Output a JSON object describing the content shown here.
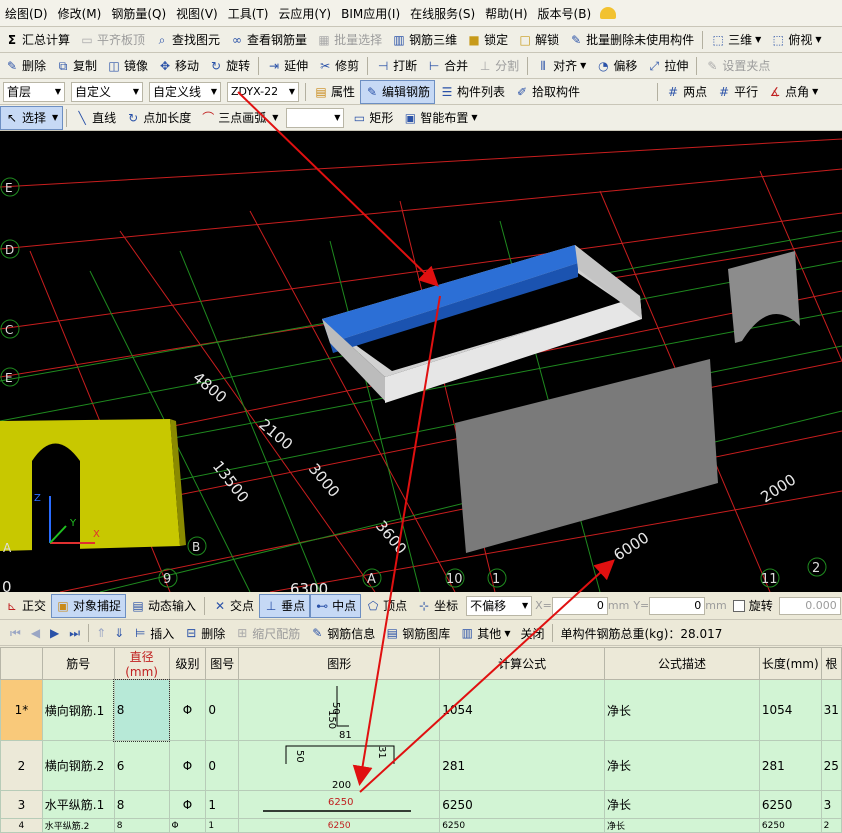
{
  "menu": [
    "绘图(D)",
    "修改(M)",
    "钢筋量(Q)",
    "视图(V)",
    "工具(T)",
    "云应用(Y)",
    "BIM应用(I)",
    "在线服务(S)",
    "帮助(H)",
    "版本号(B)"
  ],
  "toolbar1": {
    "summary": "汇总计算",
    "flat_slab": "平齐板顶",
    "find": "查找图元",
    "view_rebar": "查看钢筋量",
    "batch_select": "批量选择",
    "rebar3d": "钢筋三维",
    "lock": "锁定",
    "unlock": "解锁",
    "batch_delete": "批量删除未使用构件",
    "view3d": "三维",
    "top_view": "俯视"
  },
  "toolbar2": {
    "delete": "删除",
    "copy": "复制",
    "mirror": "镜像",
    "move": "移动",
    "rotate": "旋转",
    "extend": "延伸",
    "trim": "修剪",
    "break": "打断",
    "merge": "合并",
    "split": "分割",
    "align": "对齐",
    "offset": "偏移",
    "stretch": "拉伸",
    "set_point": "设置夹点"
  },
  "toolbar3": {
    "floor": "首层",
    "category": "自定义",
    "subtype": "自定义线",
    "component": "ZDYX-22",
    "property": "属性",
    "edit_rebar": "编辑钢筋",
    "component_list": "构件列表",
    "pick": "拾取构件",
    "two_points": "两点",
    "parallel": "平行",
    "point_angle": "点角"
  },
  "toolbar4": {
    "select": "选择",
    "line": "直线",
    "point_length": "点加长度",
    "arc3": "三点画弧",
    "rect": "矩形",
    "smart": "智能布置"
  },
  "viewport": {
    "axis_letters_left": [
      "E",
      "D",
      "C",
      "E",
      "A",
      "B"
    ],
    "axis_numbers_bottom": [
      "9",
      "A",
      "10",
      "1",
      "11",
      "2"
    ],
    "dimensions": [
      "4800",
      "2100",
      "13500",
      "3000",
      "3600",
      "6000",
      "2000",
      "6300",
      "0"
    ]
  },
  "statusbar": {
    "ortho": "正交",
    "snap": "对象捕捉",
    "dynamic": "动态输入",
    "intersect": "交点",
    "perpendicular": "垂点",
    "midpoint": "中点",
    "vertex": "顶点",
    "coord": "坐标",
    "offset_mode": "不偏移",
    "x_label": "X=",
    "x_value": "0",
    "y_label": "Y=",
    "y_value": "0",
    "mm": "mm",
    "rotate": "旋转",
    "rotate_value": "0.000"
  },
  "gridbar": {
    "insert": "插入",
    "delete": "删除",
    "scale_rebar": "缩尺配筋",
    "rebar_info": "钢筋信息",
    "rebar_library": "钢筋图库",
    "other": "其他",
    "close": "关闭",
    "total_weight": "单构件钢筋总重(kg)：28.017"
  },
  "table": {
    "headers": [
      "",
      "筋号",
      "直径(mm)",
      "级别",
      "图号",
      "图形",
      "计算公式",
      "公式描述",
      "长度(mm)",
      "根"
    ],
    "rows": [
      {
        "no": "1*",
        "name": "横向钢筋.1",
        "dia": "8",
        "grade": "Φ",
        "fig": "0",
        "formula": "1054",
        "desc": "净长",
        "length": "1054",
        "count": "31",
        "shape_a": "50",
        "shape_b": "81",
        "shape_c": "150"
      },
      {
        "no": "2",
        "name": "横向钢筋.2",
        "dia": "6",
        "grade": "Φ",
        "fig": "0",
        "formula": "281",
        "desc": "净长",
        "length": "281",
        "count": "25",
        "shape_a": "50",
        "shape_b": "31",
        "shape_c": "200"
      },
      {
        "no": "3",
        "name": "水平纵筋.1",
        "dia": "8",
        "grade": "Φ",
        "fig": "1",
        "formula": "6250",
        "desc": "净长",
        "length": "6250",
        "count": "3",
        "shape_a": "6250"
      },
      {
        "no": "4",
        "name": "水平纵筋.2",
        "dia": "8",
        "grade": "Φ",
        "fig": "1",
        "formula": "6250",
        "desc": "净长",
        "length": "6250",
        "count": "2",
        "shape_a": "6250"
      }
    ]
  }
}
